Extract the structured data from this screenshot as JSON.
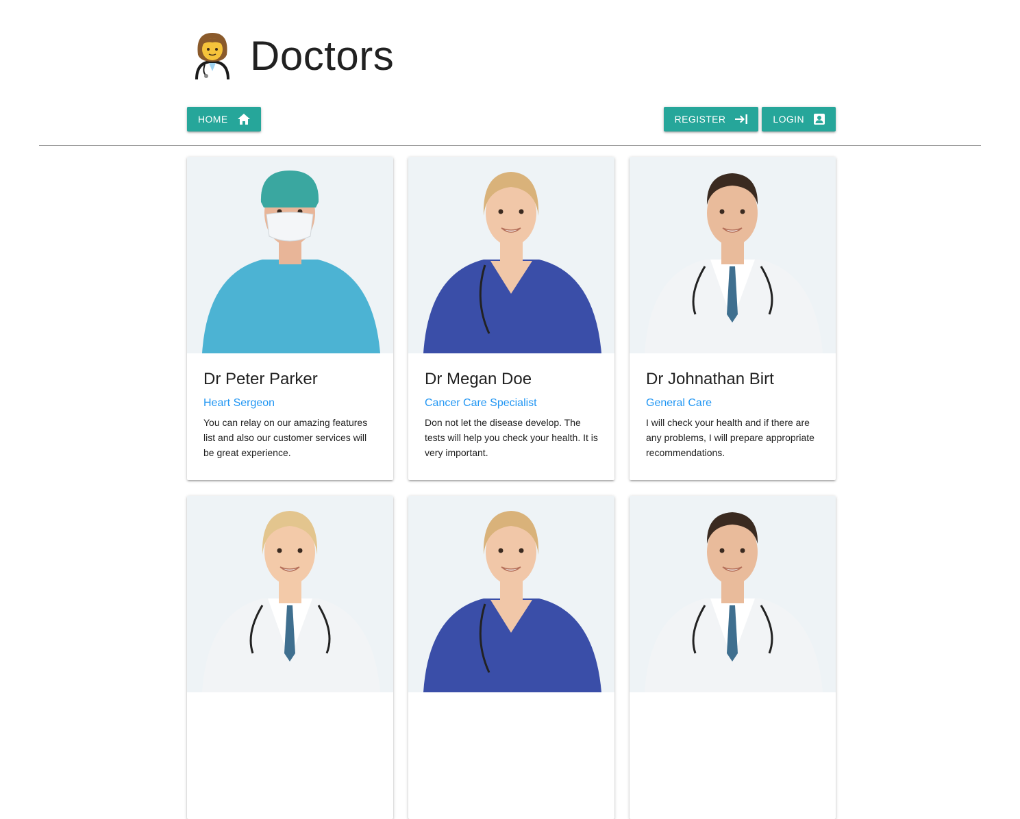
{
  "page": {
    "title": "Doctors",
    "logo_icon": "doctor-emoji-icon"
  },
  "nav": {
    "home": {
      "label": "HOME",
      "icon": "home-icon"
    },
    "register": {
      "label": "REGISTER",
      "icon": "login-arrow-icon"
    },
    "login": {
      "label": "LOGIN",
      "icon": "account-box-icon"
    },
    "accent_color": "#26a69a"
  },
  "doctors": [
    {
      "name": "Dr Peter Parker",
      "specialty": "Heart Sergeon",
      "description": "You can relay on our amazing features list and also our customer services will be great experience.",
      "portrait": "surgeon"
    },
    {
      "name": "Dr Megan Doe",
      "specialty": "Cancer Care Specialist",
      "description": "Don not let the disease develop. The tests will help you check your health. It is very important.",
      "portrait": "female-scrubs"
    },
    {
      "name": "Dr Johnathan Birt",
      "specialty": "General Care",
      "description": "I will check your health and if there are any problems, I will prepare appropriate recommendations.",
      "portrait": "male-coat"
    },
    {
      "name": "",
      "specialty": "",
      "description": "",
      "portrait": "female-blonde"
    },
    {
      "name": "",
      "specialty": "",
      "description": "",
      "portrait": "female-scrubs"
    },
    {
      "name": "",
      "specialty": "",
      "description": "",
      "portrait": "male-coat"
    }
  ]
}
